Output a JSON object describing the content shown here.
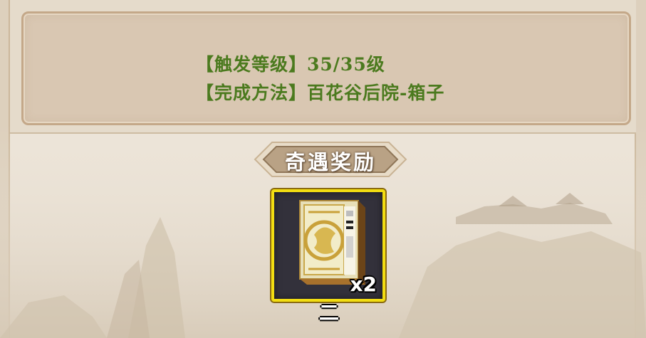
{
  "quest": {
    "trigger_level_label": "【触发等级】",
    "trigger_level_value": "35/35级",
    "method_label": "【完成方法】",
    "method_value": "百花谷后院-箱子"
  },
  "reward": {
    "title": "奇遇奖励",
    "item": {
      "icon": "book-box-icon",
      "cover_text": "二",
      "count": "x2",
      "name": "二"
    }
  },
  "colors": {
    "quest_text": "#4b7a1e",
    "slot_border": "#f2dd12",
    "panel_bg": "#d9c7b2"
  }
}
